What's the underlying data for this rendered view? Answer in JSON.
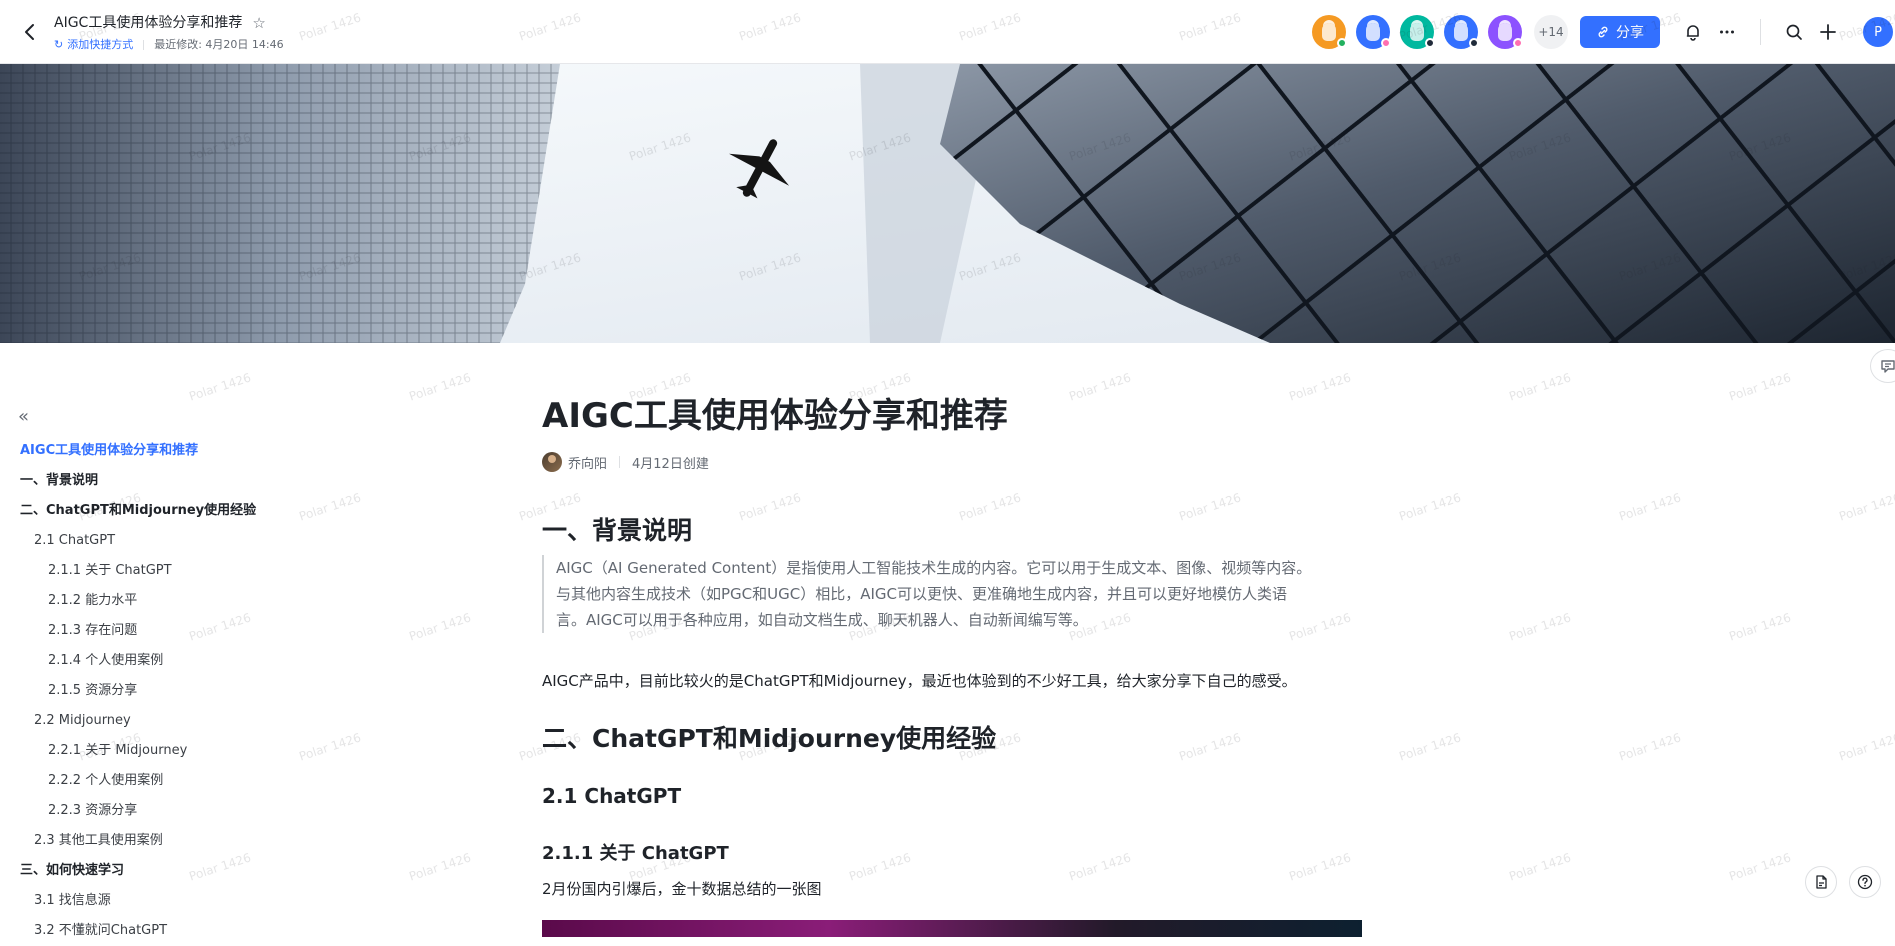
{
  "header": {
    "title": "AIGC工具使用体验分享和推荐",
    "shortcut": "添加快捷方式",
    "modified": "最近修改: 4月20日 14:46",
    "collaborator_count": "+14",
    "share_label": "分享",
    "me_initial": "P"
  },
  "collaborators": [
    {
      "color": "#f59a23",
      "dot": "#22b15f"
    },
    {
      "color": "#3370ff",
      "dot": "#ff6fb1"
    },
    {
      "color": "#00b89f",
      "dot": "#202b3a"
    },
    {
      "color": "#3370ff",
      "dot": "#202b3a"
    },
    {
      "color": "#8c52ff",
      "dot": "#ff6fb1"
    }
  ],
  "toc": {
    "items": [
      {
        "label": "AIGC工具使用体验分享和推荐",
        "level": "active"
      },
      {
        "label": "一、背景说明",
        "level": "l1"
      },
      {
        "label": "二、ChatGPT和Midjourney使用经验",
        "level": "l1"
      },
      {
        "label": "2.1 ChatGPT",
        "level": "l2"
      },
      {
        "label": "2.1.1 关于 ChatGPT",
        "level": "l3"
      },
      {
        "label": "2.1.2 能力水平",
        "level": "l3"
      },
      {
        "label": "2.1.3 存在问题",
        "level": "l3"
      },
      {
        "label": "2.1.4 个人使用案例",
        "level": "l3"
      },
      {
        "label": "2.1.5 资源分享",
        "level": "l3"
      },
      {
        "label": "2.2 Midjourney",
        "level": "l2"
      },
      {
        "label": "2.2.1 关于 Midjourney",
        "level": "l3"
      },
      {
        "label": "2.2.2 个人使用案例",
        "level": "l3"
      },
      {
        "label": "2.2.3 资源分享",
        "level": "l3"
      },
      {
        "label": "2.3 其他工具使用案例",
        "level": "l2"
      },
      {
        "label": "三、如何快速学习",
        "level": "l1"
      },
      {
        "label": "3.1 找信息源",
        "level": "l2"
      },
      {
        "label": "3.2 不懂就问ChatGPT",
        "level": "l2"
      }
    ]
  },
  "content": {
    "title": "AIGC工具使用体验分享和推荐",
    "author": "乔向阳",
    "created": "4月12日创建",
    "section1": "一、背景说明",
    "quote_line1": "AIGC（AI Generated Content）是指使用人工智能技术生成的内容。它可以用于生成文本、图像、视频等内容。",
    "quote_line2": "与其他内容生成技术（如PGC和UGC）相比，AIGC可以更快、更准确地生成内容，并且可以更好地模仿人类语",
    "quote_line3": "言。AIGC可以用于各种应用，如自动文档生成、聊天机器人、自动新闻编写等。",
    "paragraph": "AIGC产品中，目前比较火的是ChatGPT和Midjourney，最近也体验到的不少好工具，给大家分享下自己的感受。",
    "section2": "二、ChatGPT和Midjourney使用经验",
    "sub1": "2.1 ChatGPT",
    "sub1_1": "2.1.1 关于 ChatGPT",
    "caption": "2月份国内引爆后，金十数据总结的一张图"
  },
  "watermark": "Polar 1426"
}
